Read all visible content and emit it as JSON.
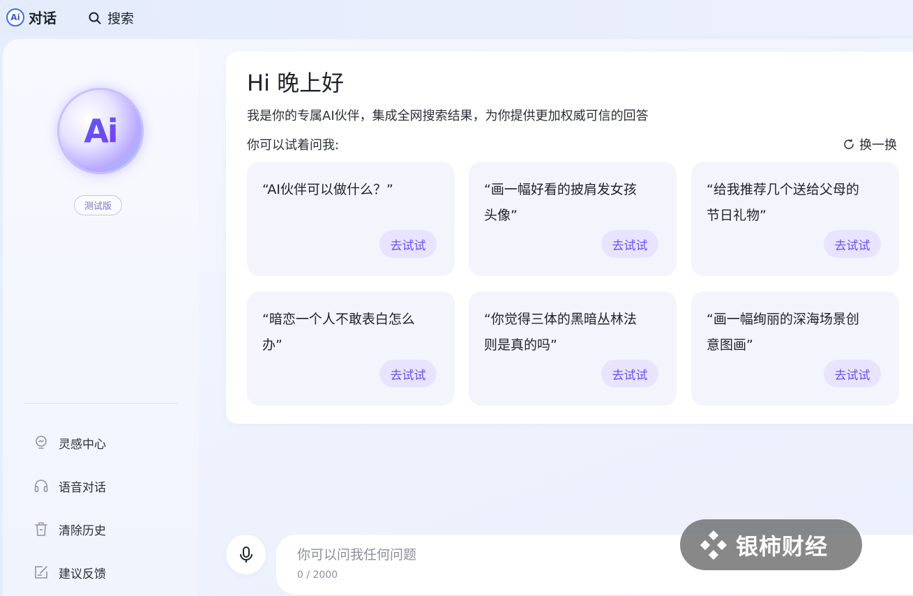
{
  "topbar": {
    "logo_text": "Ai",
    "app_title": "对话",
    "search_label": "搜索"
  },
  "sidebar": {
    "avatar_text": "Ai",
    "beta_badge": "测试版",
    "menu": [
      {
        "label": "灵感中心",
        "icon": "lightbulb-icon"
      },
      {
        "label": "语音对话",
        "icon": "headphones-icon"
      },
      {
        "label": "清除历史",
        "icon": "trash-icon"
      },
      {
        "label": "建议反馈",
        "icon": "feedback-icon"
      }
    ]
  },
  "welcome": {
    "greeting": "Hi 晚上好",
    "intro": "我是你的专属AI伙伴，集成全网搜索结果，为你提供更加权威可信的回答",
    "try_label": "你可以试着问我:",
    "refresh_label": "换一换",
    "suggestions": [
      {
        "question": "“AI伙伴可以做什么？”",
        "button": "去试试"
      },
      {
        "question": "“画一幅好看的披肩发女孩头像”",
        "button": "去试试"
      },
      {
        "question": "“给我推荐几个送给父母的节日礼物”",
        "button": "去试试"
      },
      {
        "question": "“暗恋一个人不敢表白怎么办”",
        "button": "去试试"
      },
      {
        "question": "“你觉得三体的黑暗丛林法则是真的吗”",
        "button": "去试试"
      },
      {
        "question": "“画一幅绚丽的深海场景创意图画”",
        "button": "去试试"
      }
    ]
  },
  "composer": {
    "placeholder": "你可以问我任何问题",
    "value": "",
    "counter": "0 / 2000"
  },
  "watermark": {
    "text": "银柿财经"
  },
  "colors": {
    "accent": "#6a4ff2",
    "button_bg": "#e8e4ff",
    "card_bg": "#f4f5fc"
  }
}
